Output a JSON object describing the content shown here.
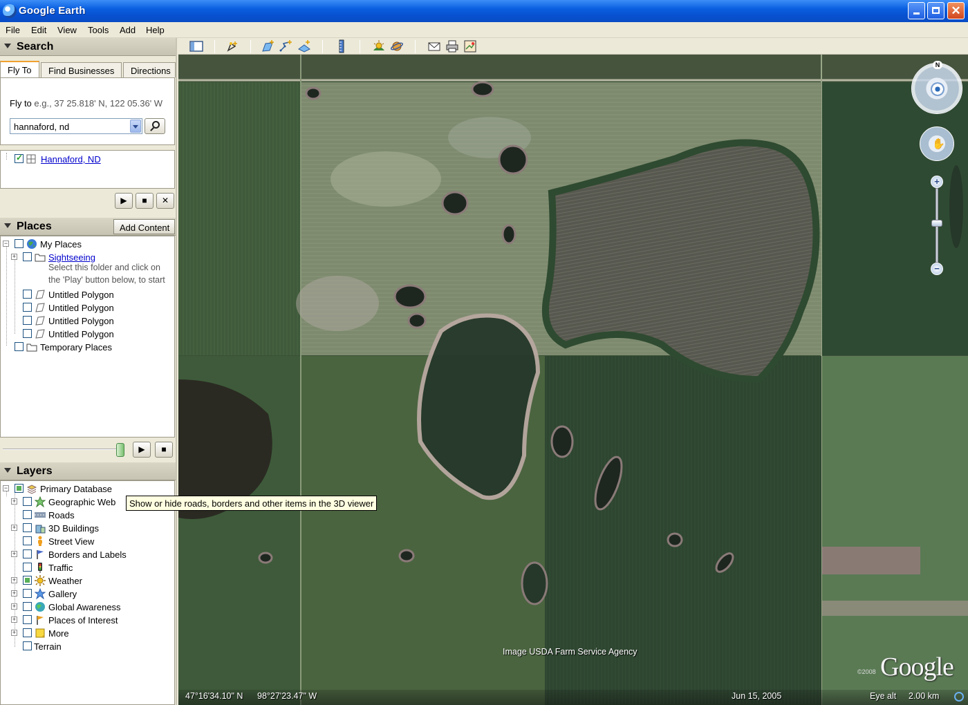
{
  "window": {
    "title": "Google Earth",
    "minimize_icon": "minimize-icon",
    "maximize_icon": "maximize-icon",
    "close_glyph": "✕"
  },
  "menu": [
    "File",
    "Edit",
    "View",
    "Tools",
    "Add",
    "Help"
  ],
  "search": {
    "header": "Search",
    "tabs": [
      "Fly To",
      "Find Businesses",
      "Directions"
    ],
    "active_tab": "Fly To",
    "flyto_label": "Fly to",
    "flyto_hint": "e.g., 37 25.818' N, 122 05.36' W",
    "input_value": "hannaford, nd",
    "results": [
      {
        "label": "Hannaford, ND",
        "checked": true
      }
    ],
    "controls": {
      "play": "▶",
      "stop": "■",
      "clear": "✕"
    }
  },
  "places": {
    "header": "Places",
    "add_content": "Add Content",
    "items": [
      {
        "label": "My Places",
        "icon": "globe-icon",
        "level": 0,
        "expander": "−"
      },
      {
        "label": "Sightseeing",
        "icon": "folder-icon",
        "level": 1,
        "expander": "+",
        "link": true
      },
      {
        "label": "Untitled Polygon",
        "icon": "polygon-icon",
        "level": 1
      },
      {
        "label": "Untitled Polygon",
        "icon": "polygon-icon",
        "level": 1
      },
      {
        "label": "Untitled Polygon",
        "icon": "polygon-icon",
        "level": 1
      },
      {
        "label": "Untitled Polygon",
        "icon": "polygon-icon",
        "level": 1
      },
      {
        "label": "Temporary Places",
        "icon": "folder-icon",
        "level": 0
      }
    ],
    "sightseeing_desc_1": "Select this folder and click on",
    "sightseeing_desc_2": "the 'Play' button below, to start",
    "controls": {
      "play": "▶",
      "stop": "■"
    }
  },
  "layers": {
    "header": "Layers",
    "items": [
      {
        "label": "Primary Database",
        "icon": "database-icon",
        "expander": "−"
      },
      {
        "label": "Geographic Web",
        "icon": "star-icon",
        "expander": "+"
      },
      {
        "label": "Roads",
        "icon": "road-icon"
      },
      {
        "label": "3D Buildings",
        "icon": "buildings-icon",
        "expander": "+"
      },
      {
        "label": "Street View",
        "icon": "pegman-icon"
      },
      {
        "label": "Borders and Labels",
        "icon": "flag-icon",
        "expander": "+"
      },
      {
        "label": "Traffic",
        "icon": "traffic-icon"
      },
      {
        "label": "Weather",
        "icon": "sun-icon",
        "expander": "+"
      },
      {
        "label": "Gallery",
        "icon": "star-icon",
        "expander": "+"
      },
      {
        "label": "Global Awareness",
        "icon": "globe-icon",
        "expander": "+"
      },
      {
        "label": "Places of Interest",
        "icon": "flag-icon",
        "expander": "+"
      },
      {
        "label": "More",
        "icon": "note-icon",
        "expander": "+"
      },
      {
        "label": "Terrain",
        "icon": ""
      }
    ],
    "tooltip": "Show or hide roads, borders and other items in the 3D viewer"
  },
  "toolbar": [
    "sidebar-toggle-icon",
    "placemark-icon",
    "polygon-add-icon",
    "path-icon",
    "overlay-icon",
    "ruler-icon",
    "sunlight-icon",
    "planet-icon",
    "email-icon",
    "print-icon",
    "maps-icon"
  ],
  "viewer": {
    "imagery_credit": "Image USDA Farm Service Agency",
    "copyright": "©2008",
    "logo": "Google",
    "latitude": "47°16'34.10\" N",
    "longitude": "98°27'23.47\" W",
    "date": "Jun 15, 2005",
    "eye_alt_label": "Eye alt",
    "eye_alt_value": "2.00 km",
    "compass_north": "N"
  }
}
